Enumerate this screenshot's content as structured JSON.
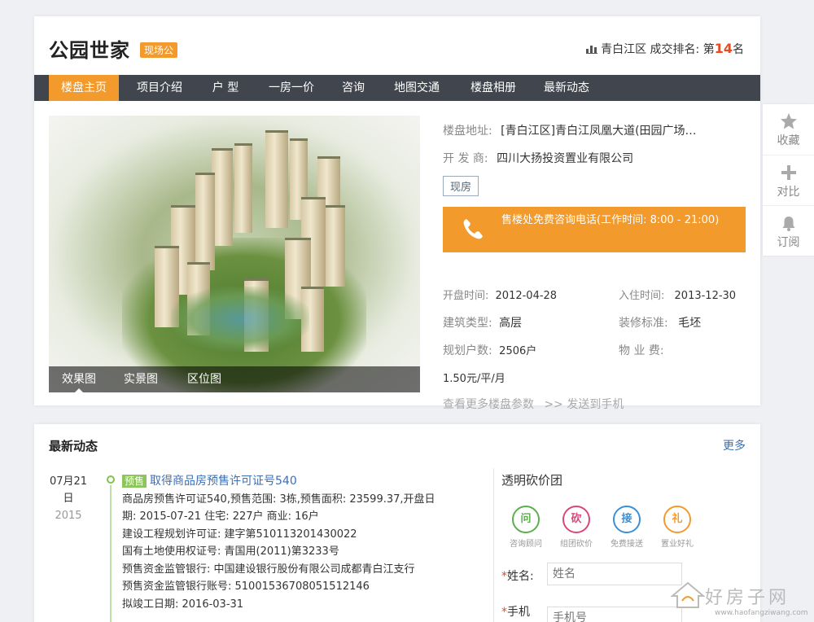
{
  "header": {
    "title": "公园世家",
    "status_tag": "现场公",
    "rank_prefix": "青白江区 成交排名: 第",
    "rank_number": "14",
    "rank_suffix": "名"
  },
  "nav": {
    "items": [
      "楼盘主页",
      "项目介绍",
      "户 型",
      "一房一价",
      "咨询",
      "地图交通",
      "楼盘相册",
      "最新动态"
    ],
    "active_index": 0
  },
  "photo": {
    "tabs": [
      "效果图",
      "实景图",
      "区位图"
    ],
    "active_tab": 0
  },
  "info": {
    "address_label": "楼盘地址:",
    "address_value": "[青白江区]青白江凤凰大道(田园广场…",
    "developer_label": "开 发 商:",
    "developer_value": "四川大扬投资置业有限公司",
    "status": "现房",
    "phone_text": "售楼处免费咨询电话(工作时间: 8:00 - 21:00)",
    "open_label": "开盘时间:",
    "open_value": "2012-04-28",
    "move_label": "入住时间:",
    "move_value": "2013-12-30",
    "type_label": "建筑类型:",
    "type_value": "高层",
    "decor_label": "装修标准:",
    "decor_value": "毛坯",
    "households_label": "规划户数:",
    "households_value": "2506户",
    "fee_label": "物 业 费:",
    "fee_value": "1.50元/平/月",
    "more_params": "查看更多楼盘参数",
    "send_phone": ">> 发送到手机"
  },
  "side": {
    "favorite": "收藏",
    "compare": "对比",
    "subscribe": "订阅"
  },
  "news": {
    "title": "最新动态",
    "more": "更多",
    "date_md": "07月21",
    "date_day": "日",
    "date_year": "2015",
    "badge": "预售",
    "headline": "取得商品房预售许可证号540",
    "lines": [
      "商品房预售许可证540,预售范围: 3栋,预售面积: 23599.37,开盘日",
      "期: 2015-07-21 住宅: 227户 商业: 16户",
      "建设工程规划许可证: 建字第510113201430022",
      "国有土地使用权证号: 青国用(2011)第3233号",
      "预售资金监管银行: 中国建设银行股份有限公司成都青白江支行",
      "预售资金监管银行账号: 51001536708051512146",
      "拟竣工日期: 2016-03-31"
    ]
  },
  "group_buy": {
    "title": "透明砍价团",
    "buttons": [
      {
        "glyph": "问",
        "label": "咨询顾问",
        "color": "#5ab04a"
      },
      {
        "glyph": "砍",
        "label": "组团砍价",
        "color": "#d9477a"
      },
      {
        "glyph": "接",
        "label": "免费接送",
        "color": "#3b8fd6"
      },
      {
        "glyph": "礼",
        "label": "置业好礼",
        "color": "#f39a2d"
      }
    ],
    "name_label": "姓名:",
    "name_placeholder": "姓名",
    "phone_label": "手机",
    "phone_placeholder": "手机号",
    "required_mark": "*"
  },
  "watermark": {
    "text": "好房子网",
    "url": "www.haofangziwang.com"
  }
}
